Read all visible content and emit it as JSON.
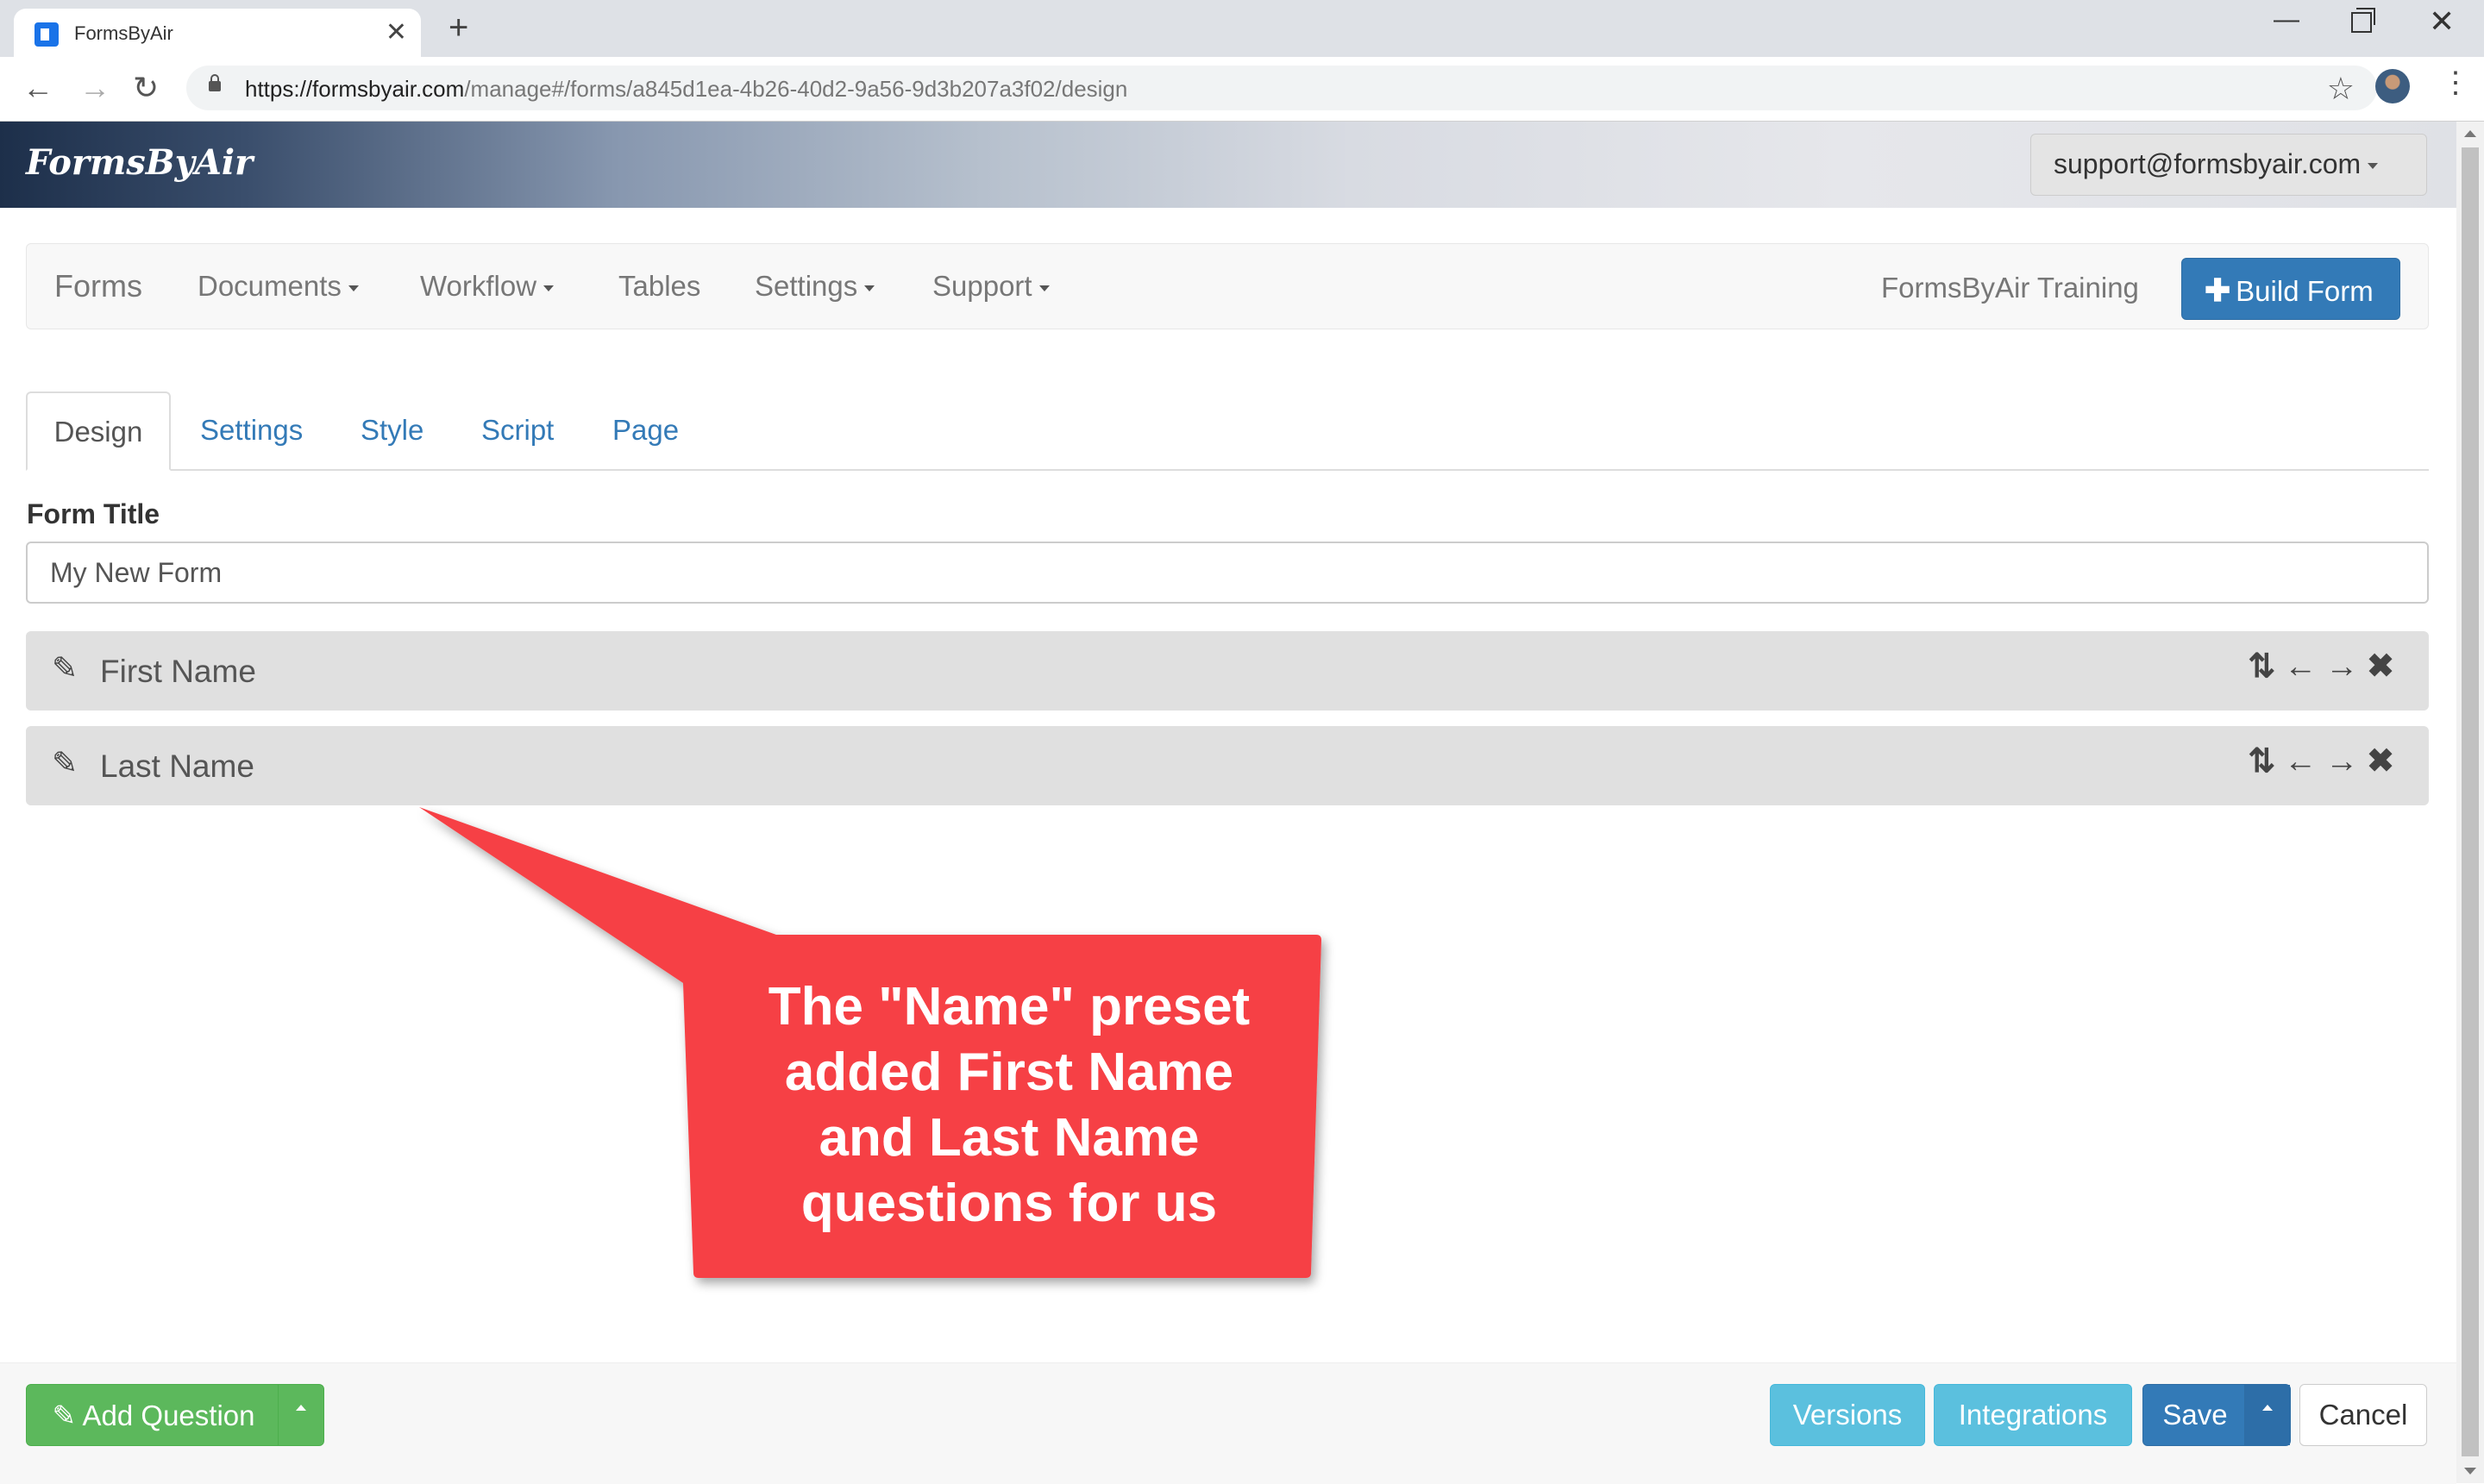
{
  "browser": {
    "tab_title": "FormsByAir",
    "url_domain": "https://formsbyair.com",
    "url_path": "/manage#/forms/a845d1ea-4b26-40d2-9a56-9d3b207a3f02/design"
  },
  "header": {
    "logo": "FormsByAir",
    "user_email": "support@formsbyair.com"
  },
  "navbar": {
    "brand": "Forms",
    "items": [
      "Documents",
      "Workflow",
      "Tables",
      "Settings",
      "Support"
    ],
    "account_name": "FormsByAir Training",
    "build_form_label": "Build Form"
  },
  "tabs": [
    "Design",
    "Settings",
    "Style",
    "Script",
    "Page"
  ],
  "active_tab": "Design",
  "form": {
    "title_label": "Form Title",
    "title_value": "My New Form",
    "questions": [
      {
        "label": "First Name"
      },
      {
        "label": "Last Name"
      }
    ]
  },
  "callout": {
    "lines": [
      "The \"Name\" preset",
      "added First Name",
      "and Last Name",
      "questions for us"
    ],
    "color": "#f64144"
  },
  "footer": {
    "add_question_label": "Add Question",
    "versions_label": "Versions",
    "integrations_label": "Integrations",
    "save_label": "Save",
    "cancel_label": "Cancel"
  },
  "colors": {
    "primary": "#337ab7",
    "success": "#5cb85c",
    "info": "#5bc0de"
  }
}
